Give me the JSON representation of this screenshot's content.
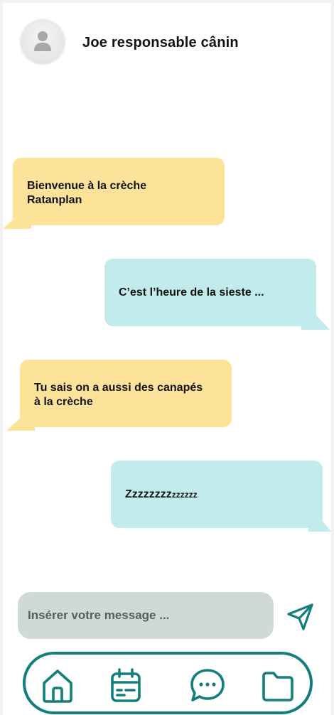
{
  "header": {
    "contact_name": "Joe responsable cânin",
    "avatar_icon": "user-avatar-icon"
  },
  "messages": [
    {
      "side": "received",
      "color": "#fde29a",
      "text": "Bienvenue à la crèche Ratanplan"
    },
    {
      "side": "sent",
      "color": "#c1ebec",
      "text": "C’est l’heure de la sieste ..."
    },
    {
      "side": "received",
      "color": "#fde29a",
      "text": "Tu sais on a aussi des canapés à la crèche"
    },
    {
      "side": "sent",
      "color": "#c1ebec",
      "text_big": "Zzzzzzzz",
      "text_small": "zzzzzz"
    }
  ],
  "composer": {
    "placeholder": "Insérer votre message ...",
    "value": "",
    "send_icon": "send-icon"
  },
  "nav": {
    "accent_color": "#137f7b",
    "items": [
      {
        "icon": "home-icon"
      },
      {
        "icon": "calendar-icon"
      },
      {
        "icon": "chat-icon"
      },
      {
        "icon": "folder-icon"
      }
    ]
  }
}
